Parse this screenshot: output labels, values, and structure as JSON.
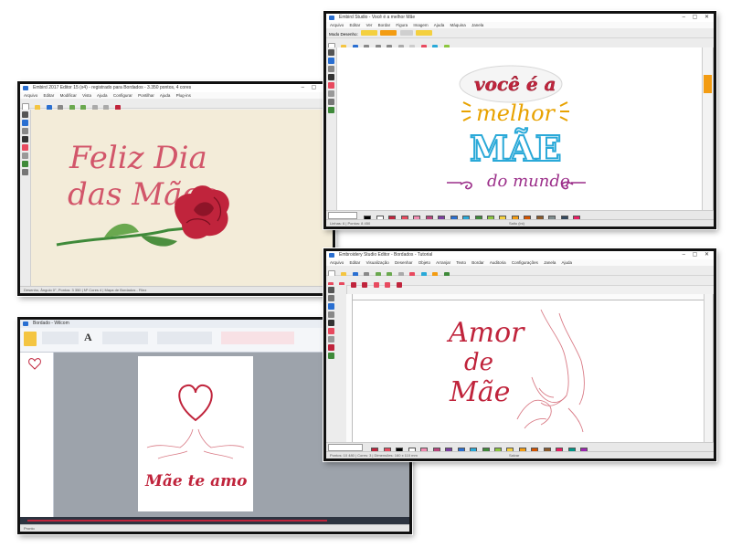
{
  "window1": {
    "title": "Embird 2017 Editor 15 (x4) - registrado para Bordados - 3.350 pontos, 4 cores",
    "menu": [
      "Arquivo",
      "Editar",
      "Modificar",
      "Vista",
      "Ajuda",
      "Configurar",
      "Pontilhar",
      "Ajuda",
      "Plug-ins",
      "Opções"
    ],
    "design_line1": "Feliz Dia",
    "design_line2": "das Mães",
    "status": "Desenho, Ângulo 0°, Pontos: 3 350 | Nº Cores 4 | Mapa de Bordados - Filez"
  },
  "window2": {
    "title": "Embird Studio - Você é a melhor Mãe",
    "menu": [
      "Arquivo",
      "Editar",
      "Ver",
      "Bordar",
      "Figura",
      "Imagem",
      "Ajuda",
      "Máquina",
      "Janela",
      "Ajuda"
    ],
    "mode_label": "Modo Desenho:",
    "design_line1": "você é a",
    "design_line2": "melhor",
    "design_line3": "MÃE",
    "design_line4": "do mundo",
    "status": "Linhas: 6 | Pontos: 8 450",
    "footer": "Salto (ini)"
  },
  "window3": {
    "title": "Bordado - Wilcom",
    "design_line": "Mãe te amo",
    "status": "Pronto"
  },
  "window4": {
    "title": "Embroidery Studio Editor - Bordados - Tutorial",
    "menu": [
      "Arquivo",
      "Editar",
      "Visualização",
      "Desenhar",
      "Objeto",
      "Arranjar",
      "Texto",
      "Bordar",
      "Auditoria",
      "Configurações",
      "Janela",
      "Ajuda"
    ],
    "design_line1": "Amor",
    "design_line2": "de",
    "design_line3": "Mãe",
    "status": "Pontos: 10 480 | Cores: 3 | Dimensões: 160 x 110 mm",
    "footer": "Salvar"
  },
  "colors": {
    "rose_text": "#d2566a",
    "deep_red": "#c0243c",
    "plum": "#b9457c",
    "green": "#3f8a3a"
  },
  "palette_colors": [
    "#000000",
    "#ffffff",
    "#c0243c",
    "#e84a5f",
    "#f28bb1",
    "#b9457c",
    "#7b3fa0",
    "#2a6fd1",
    "#2aa9d8",
    "#3f8a3a",
    "#8cc63f",
    "#f4d03f",
    "#f39c12",
    "#d35400",
    "#8b5a2b",
    "#7f8c8d",
    "#34495e",
    "#e91e63",
    "#009688",
    "#9c27b0"
  ]
}
